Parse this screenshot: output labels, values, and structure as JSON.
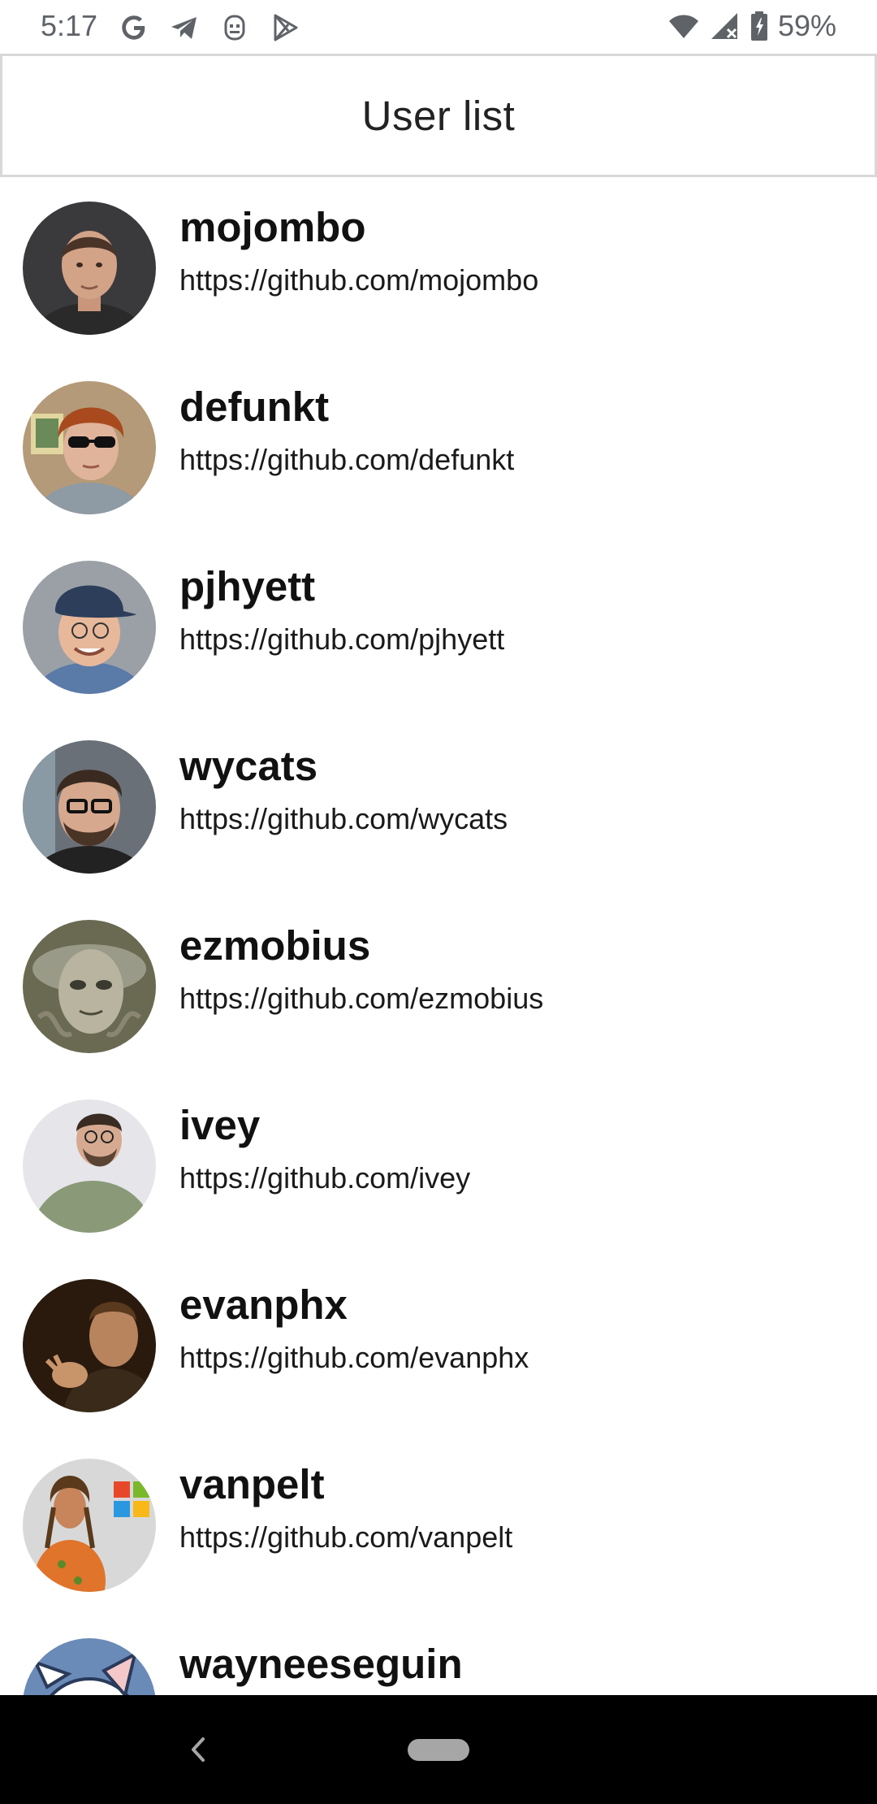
{
  "status_bar": {
    "time": "5:17",
    "left_icons": [
      "google-icon",
      "telegram-icon",
      "assistant-icon",
      "play-store-icon"
    ],
    "right_icons": [
      "wifi-icon",
      "signal-icon",
      "battery-icon"
    ],
    "battery": "59%"
  },
  "header": {
    "title": "User list"
  },
  "users": [
    {
      "login": "mojombo",
      "url": "https://github.com/mojombo"
    },
    {
      "login": "defunkt",
      "url": "https://github.com/defunkt"
    },
    {
      "login": "pjhyett",
      "url": "https://github.com/pjhyett"
    },
    {
      "login": "wycats",
      "url": "https://github.com/wycats"
    },
    {
      "login": "ezmobius",
      "url": "https://github.com/ezmobius"
    },
    {
      "login": "ivey",
      "url": "https://github.com/ivey"
    },
    {
      "login": "evanphx",
      "url": "https://github.com/evanphx"
    },
    {
      "login": "vanpelt",
      "url": "https://github.com/vanpelt"
    },
    {
      "login": "wayneeseguin",
      "url": ""
    }
  ],
  "nav_bar": {
    "icons": [
      "back-icon",
      "home-pill-icon"
    ]
  },
  "colors": {
    "header_border": "#d8d8d8",
    "nav_background": "#000000",
    "status_text": "#5f6368"
  }
}
